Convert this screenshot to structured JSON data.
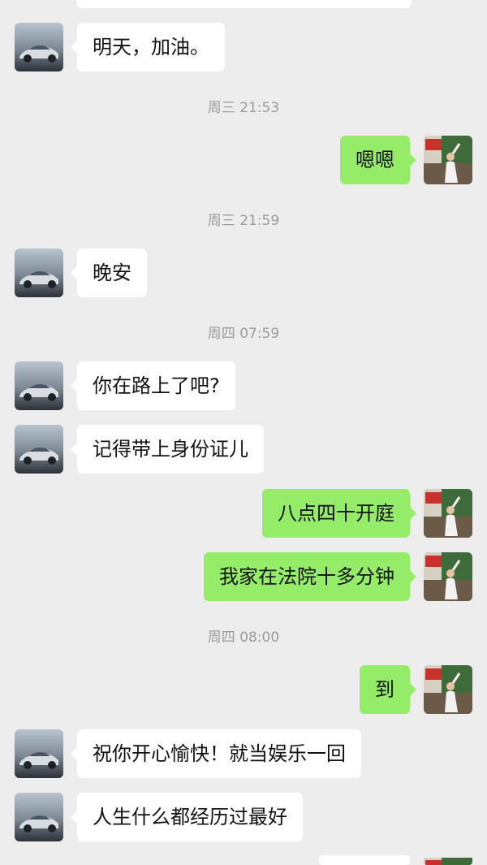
{
  "app": {
    "accent_out": "#95ec69",
    "accent_in": "#ffffff",
    "background": "#ededed"
  },
  "contact": {
    "avatar_icon": "car-avatar-icon"
  },
  "me": {
    "avatar_icon": "photo-avatar-icon"
  },
  "messages": [
    {
      "type": "in",
      "text": "明天，加油。"
    },
    {
      "type": "time",
      "text": "周三 21:53"
    },
    {
      "type": "out",
      "text": "嗯嗯"
    },
    {
      "type": "time",
      "text": "周三 21:59"
    },
    {
      "type": "in",
      "text": "晚安"
    },
    {
      "type": "time",
      "text": "周四 07:59"
    },
    {
      "type": "in",
      "text": "你在路上了吧?"
    },
    {
      "type": "in",
      "text": "记得带上身份证儿"
    },
    {
      "type": "out",
      "text": "八点四十开庭"
    },
    {
      "type": "out",
      "text": "我家在法院十多分钟"
    },
    {
      "type": "time",
      "text": "周四 08:00"
    },
    {
      "type": "out",
      "text": "到"
    },
    {
      "type": "in",
      "text": "祝你开心愉快！就当娱乐一回"
    },
    {
      "type": "in",
      "text": "人生什么都经历过最好"
    }
  ]
}
